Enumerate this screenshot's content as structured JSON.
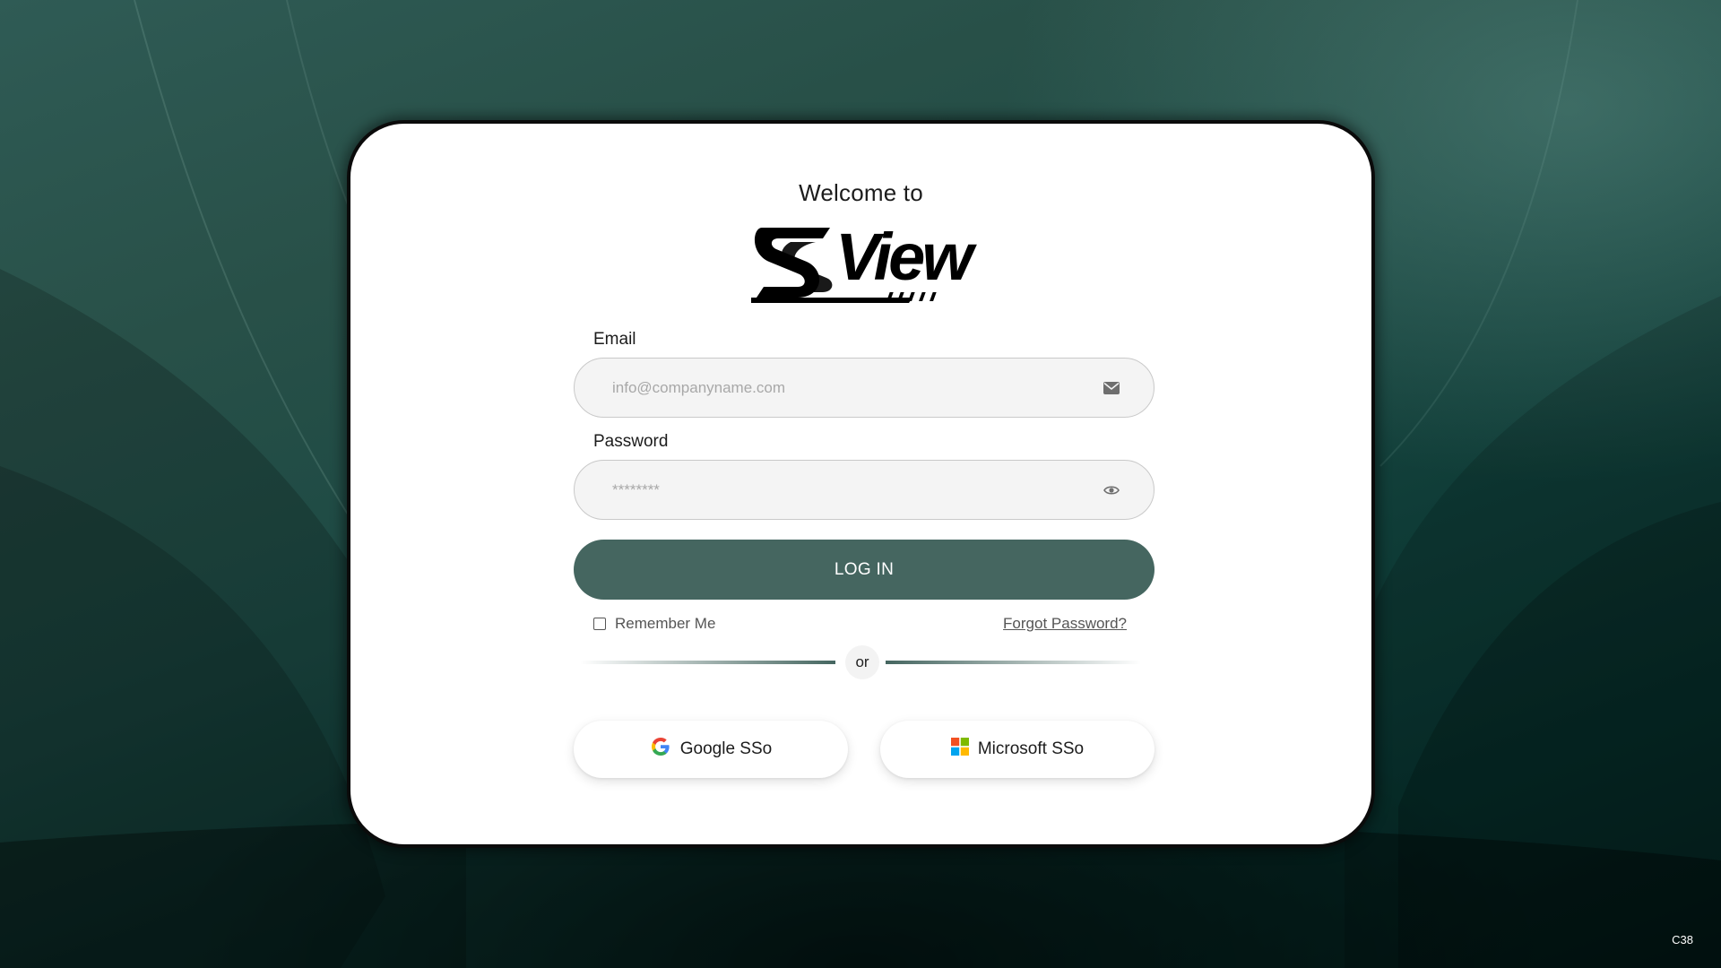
{
  "header": {
    "welcome_text": "Welcome to",
    "logo_text": "SView"
  },
  "email": {
    "label": "Email",
    "placeholder": "info@companyname.com",
    "icon": "envelope-icon"
  },
  "password": {
    "label": "Password",
    "placeholder": "********",
    "icon": "eye-icon"
  },
  "login_button": {
    "label": "LOG IN"
  },
  "remember_me": {
    "label": "Remember Me",
    "checked": false
  },
  "forgot_password": {
    "label": "Forgot Password?"
  },
  "divider": {
    "text": "or"
  },
  "sso": {
    "google_label": "Google SSo",
    "microsoft_label": "Microsoft SSo"
  },
  "footer": {
    "code": "C38"
  },
  "colors": {
    "accent": "#456660",
    "card_border": "#0b0b0b",
    "background": "#1d4a44"
  }
}
